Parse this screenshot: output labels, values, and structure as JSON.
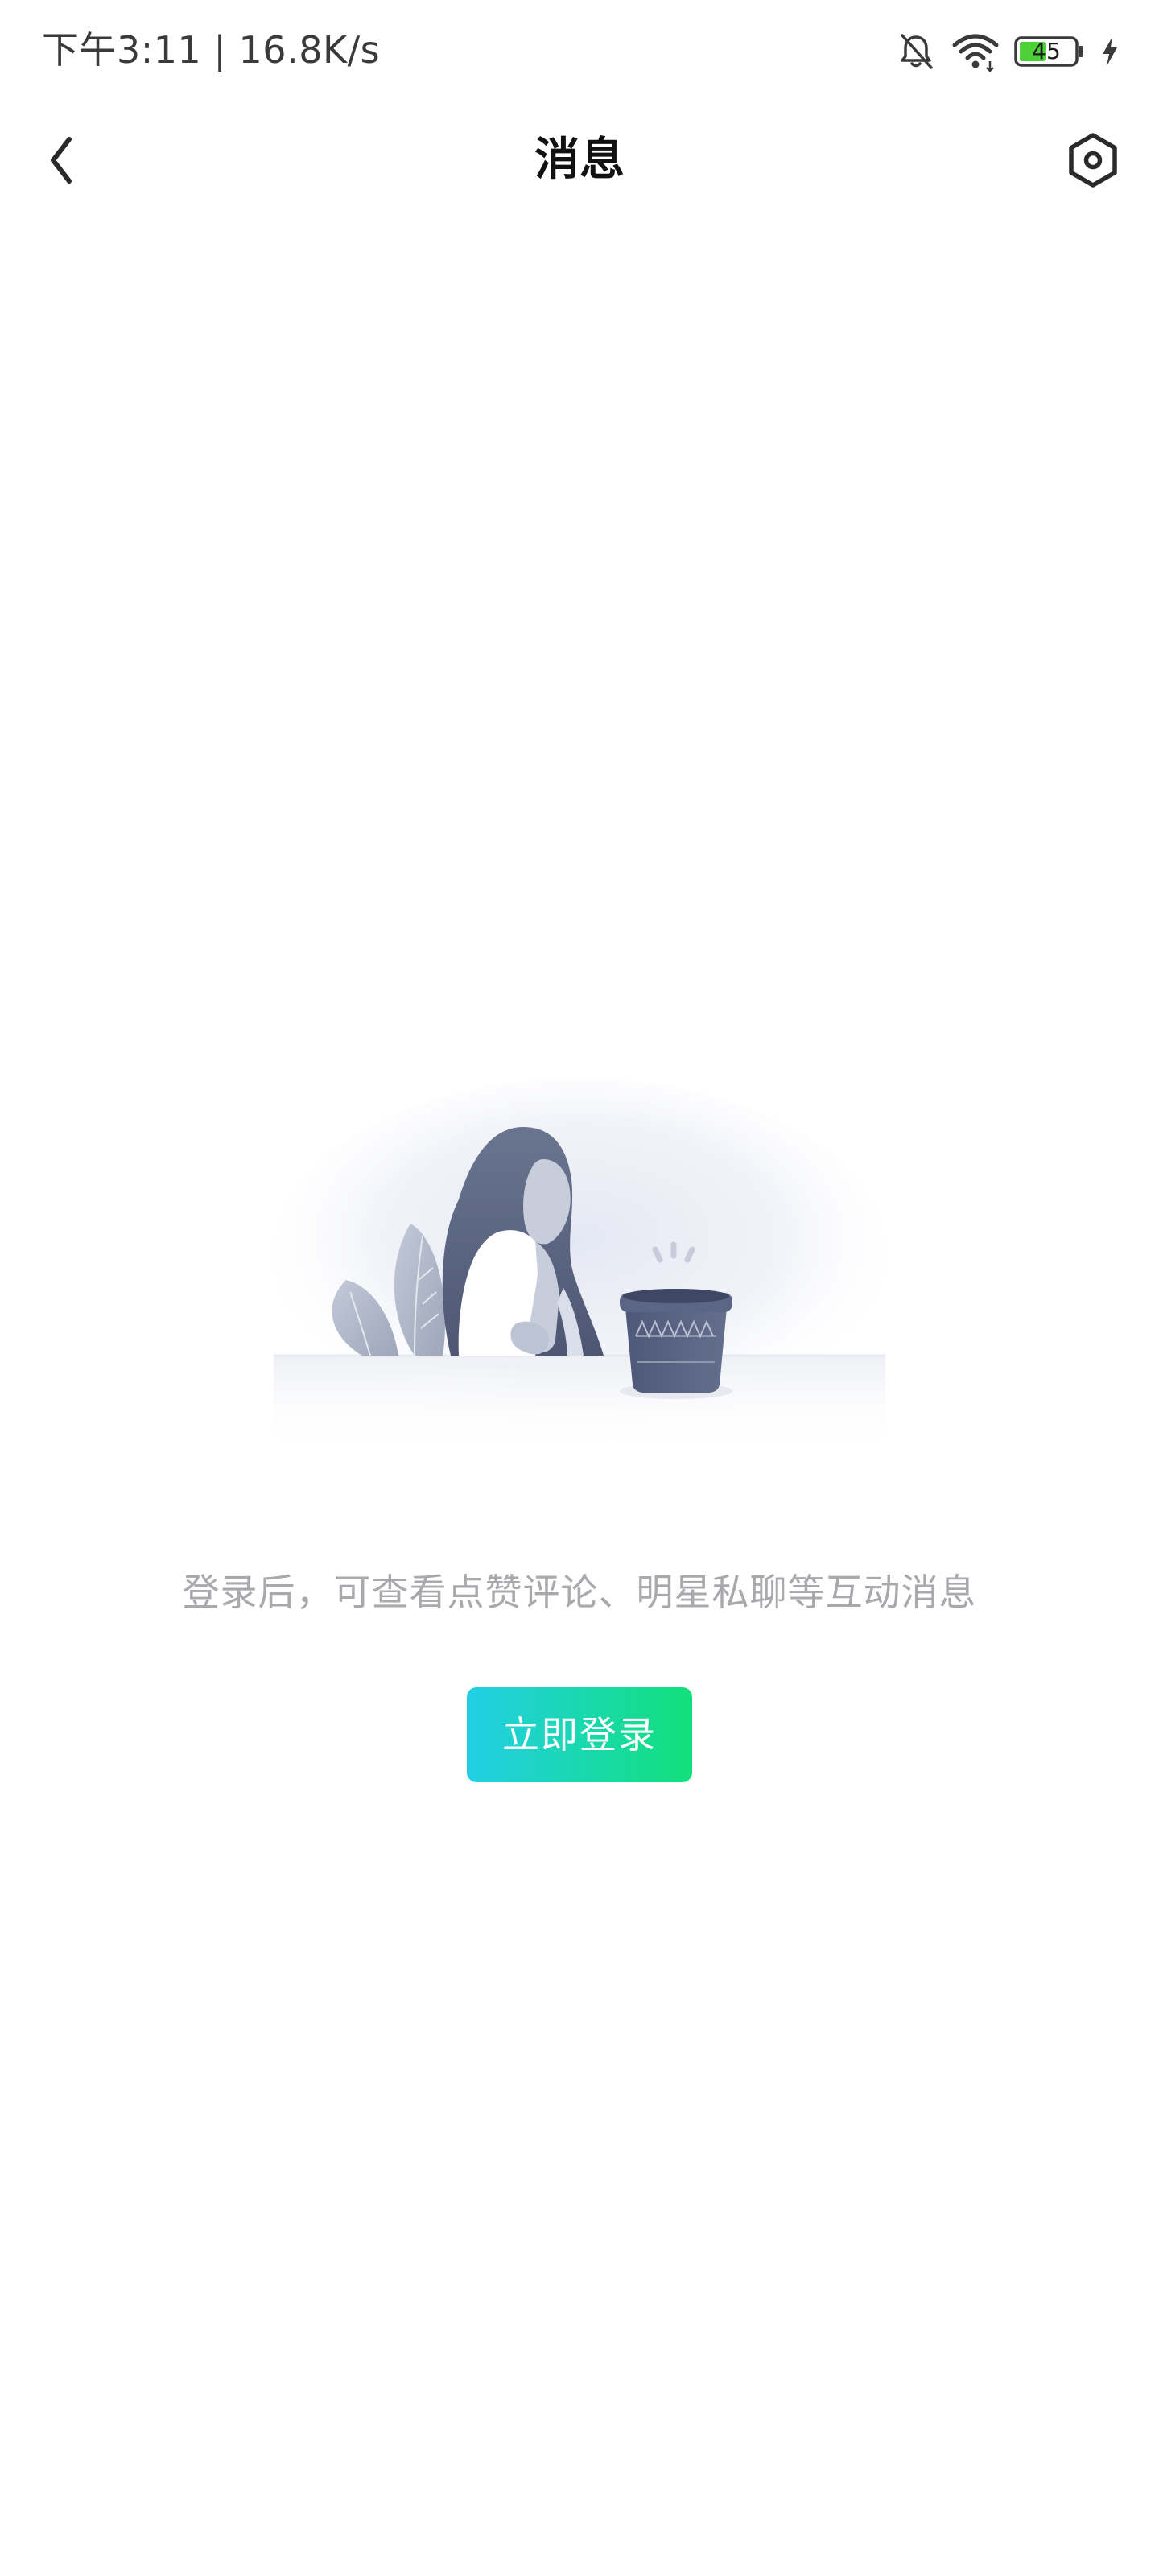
{
  "status_bar": {
    "time_speed": "下午3:11 | 16.8K/s",
    "battery_level": "45",
    "icons": [
      "mute-bell-icon",
      "wifi-icon",
      "battery-icon",
      "charging-icon"
    ]
  },
  "header": {
    "title": "消息",
    "back_icon": "chevron-left-icon",
    "settings_icon": "hexagon-settings-icon"
  },
  "empty_state": {
    "illustration": "woman-with-flowerpot-illustration",
    "message": "登录后，可查看点赞评论、明星私聊等互动消息",
    "login_button_label": "立即登录"
  },
  "colors": {
    "button_gradient_start": "#22cfe6",
    "button_gradient_end": "#12e07a",
    "message_text": "#a9a9ad",
    "illustration_primary": "#5f6a85",
    "battery_fill": "#4cd137"
  }
}
